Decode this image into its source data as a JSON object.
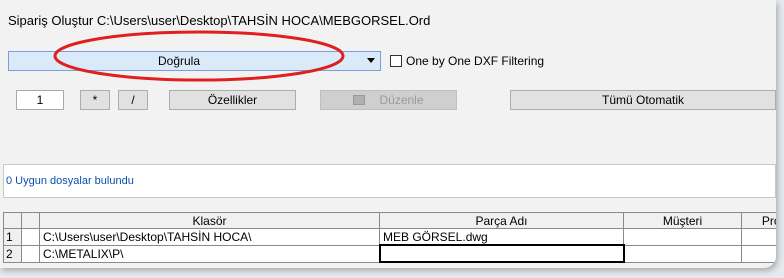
{
  "window": {
    "title": "Sipariş Oluştur C:\\Users\\user\\Desktop\\TAHSİN HOCA\\MEBGORSEL.Ord"
  },
  "toolbar": {
    "mode_select_value": "Doğrula",
    "dxf_filter_label": "One by One DXF Filtering",
    "quantity_value": "1",
    "multiply_label": "*",
    "divide_label": "/",
    "properties_label": "Özellikler",
    "edit_label": "Düzenle",
    "auto_all_label": "Tümü Otomatik"
  },
  "status": {
    "message": "0 Uygun dosyalar bulundu"
  },
  "table": {
    "columns": [
      "Klasör",
      "Parça Adı",
      "Müşteri",
      "Proj"
    ],
    "rows": [
      {
        "num": "1",
        "cells": [
          "C:\\Users\\user\\Desktop\\TAHSİN HOCA\\",
          "MEB GÖRSEL.dwg",
          "",
          ""
        ]
      },
      {
        "num": "2",
        "cells": [
          "C:\\METALIX\\P\\",
          "",
          "",
          ""
        ]
      }
    ]
  },
  "annotation": {
    "color": "#e0201e"
  }
}
